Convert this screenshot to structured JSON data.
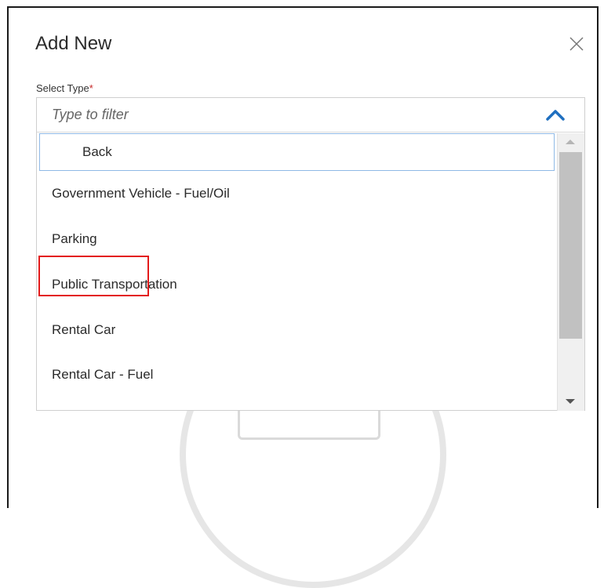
{
  "dialog": {
    "title": "Add New",
    "close_icon": "close-icon"
  },
  "field": {
    "label": "Select Type",
    "required_marker": "*",
    "filter_placeholder": "Type to filter",
    "filter_value": "",
    "toggle_icon": "chevron-up-icon"
  },
  "dropdown": {
    "options": [
      {
        "label": "Back"
      },
      {
        "label": "Government Vehicle - Fuel/Oil"
      },
      {
        "label": "Parking"
      },
      {
        "label": "Public Transportation"
      },
      {
        "label": "Rental Car"
      },
      {
        "label": "Rental Car - Fuel"
      }
    ],
    "focused_option": "Back",
    "highlighted_option": "Parking"
  },
  "colors": {
    "accent": "#1f6fbf",
    "required": "#c62828",
    "highlight_box": "#e31b1b",
    "focus_border": "#8fb9e6"
  }
}
